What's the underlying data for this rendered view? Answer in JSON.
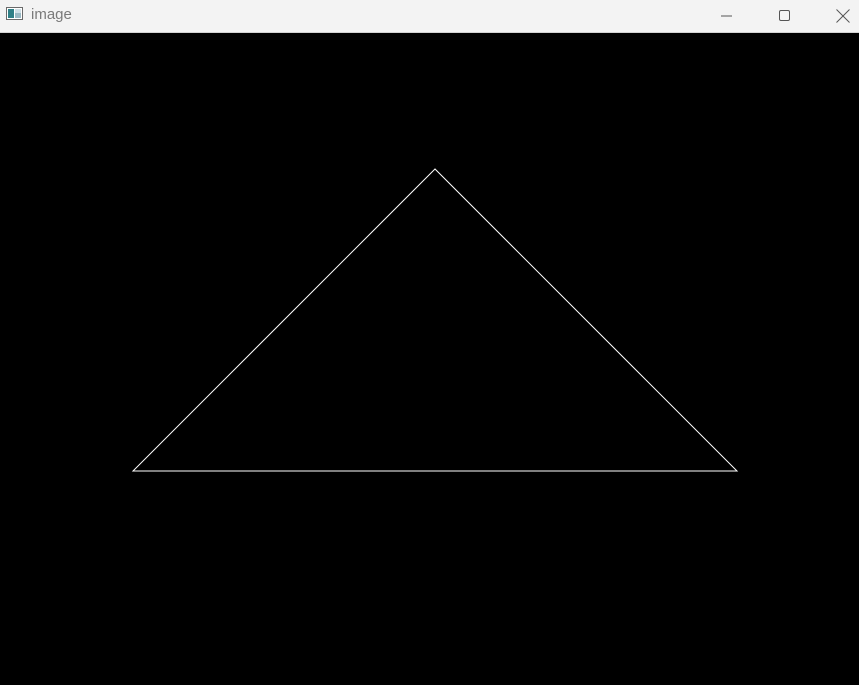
{
  "window": {
    "title": "image",
    "icon": "app-window-icon"
  },
  "controls": {
    "minimize_icon": "minimize-icon",
    "maximize_icon": "maximize-icon",
    "close_icon": "close-icon"
  },
  "canvas": {
    "background": "#000000",
    "shape": {
      "type": "triangle",
      "stroke": "#ffffff",
      "fill": "none"
    }
  }
}
